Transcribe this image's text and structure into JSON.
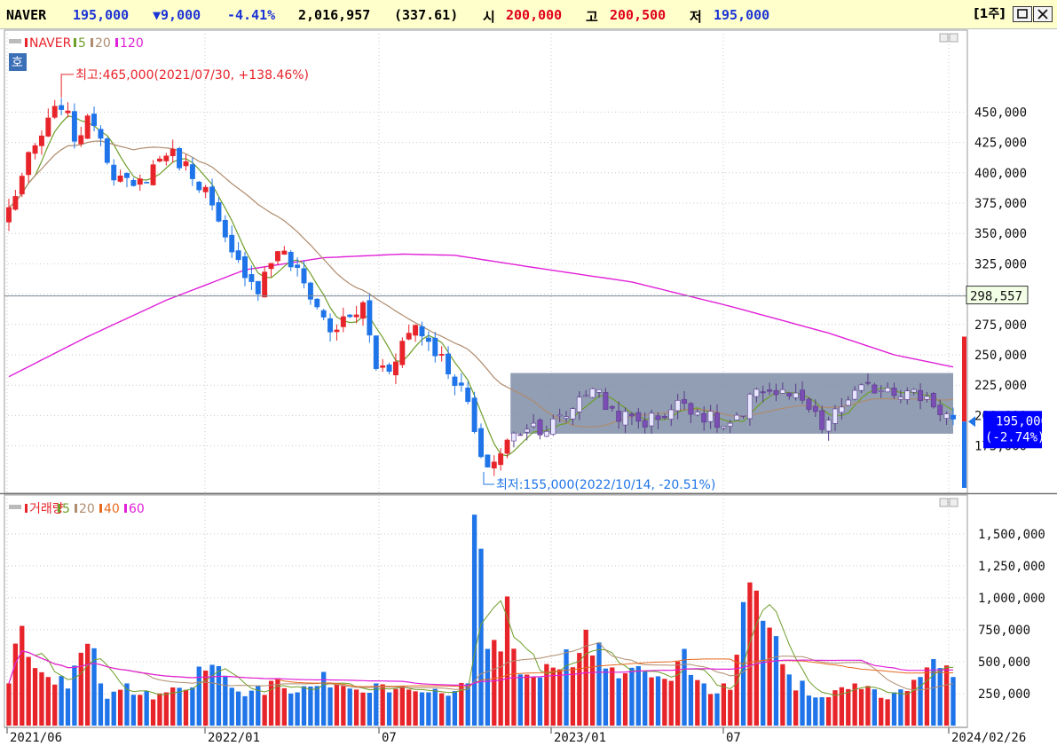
{
  "header": {
    "ticker": "NAVER",
    "price": "195,000",
    "change": "▼9,000",
    "change_pct": "-4.41%",
    "volume": "2,016,957",
    "volume_ratio": "(337.61)",
    "open_label": "시",
    "open": "200,000",
    "high_label": "고",
    "high": "200,500",
    "low_label": "저",
    "low": "195,000",
    "period_button": "[1주]",
    "restore_icon": "restore-icon",
    "close_icon": "close-icon"
  },
  "colors": {
    "up": "#e8242b",
    "down": "#1e74e8",
    "ma5": "#6e9e2a",
    "ma20": "#b08c6e",
    "ma40": "#e66a1e",
    "ma60_120": "#e020d8",
    "box": "#8291a8",
    "current": "#0000ff"
  },
  "chart_data": [
    {
      "type": "candlestick",
      "title": "NAVER",
      "legend": [
        {
          "label": "NAVER",
          "color": "#e8242b"
        },
        {
          "label": "5",
          "color": "#6e9e2a"
        },
        {
          "label": "20",
          "color": "#b08c6e"
        },
        {
          "label": "120",
          "color": "#e020d8"
        }
      ],
      "hoga_button": "호",
      "y_ticks": [
        "450,000",
        "425,000",
        "400,000",
        "375,000",
        "350,000",
        "325,000",
        "300,000",
        "275,000",
        "250,000",
        "225,000",
        "200,000",
        "175,000"
      ],
      "ylim": [
        155000,
        470000
      ],
      "x_labels": [
        "2021/06",
        "2022/01",
        "07",
        "2023/01",
        "07",
        "2024/02/26"
      ],
      "annotations": {
        "high": "최고:465,000(2021/07/30, +138.46%)",
        "low": "최저:155,000(2022/10/14, -20.51%)",
        "crosshair_value": "298,557",
        "current_price": "195,000",
        "current_pct": "(-2.74%)"
      },
      "box_range": {
        "x_start": "2022/11",
        "x_end": "2024/02/26",
        "y_low": 185000,
        "y_high": 235000
      },
      "weeks": 145,
      "x_start": "2021/05/31",
      "x_end": "2024/02/26",
      "close_anchors": [
        [
          0,
          370000
        ],
        [
          3,
          410000
        ],
        [
          6,
          440000
        ],
        [
          8,
          458000
        ],
        [
          10,
          430000
        ],
        [
          13,
          445000
        ],
        [
          16,
          400000
        ],
        [
          19,
          385000
        ],
        [
          22,
          405000
        ],
        [
          24,
          418000
        ],
        [
          26,
          410000
        ],
        [
          28,
          400000
        ],
        [
          30,
          385000
        ],
        [
          32,
          355000
        ],
        [
          34,
          330000
        ],
        [
          36,
          320000
        ],
        [
          38,
          305000
        ],
        [
          41,
          338000
        ],
        [
          43,
          325000
        ],
        [
          46,
          300000
        ],
        [
          49,
          270000
        ],
        [
          52,
          280000
        ],
        [
          54,
          290000
        ],
        [
          56,
          240000
        ],
        [
          58,
          240000
        ],
        [
          60,
          260000
        ],
        [
          62,
          275000
        ],
        [
          65,
          255000
        ],
        [
          68,
          230000
        ],
        [
          70,
          210000
        ],
        [
          72,
          160000
        ],
        [
          74,
          162000
        ],
        [
          76,
          178000
        ],
        [
          79,
          193000
        ],
        [
          82,
          190000
        ],
        [
          85,
          200000
        ],
        [
          87,
          215000
        ],
        [
          89,
          225000
        ],
        [
          91,
          208000
        ],
        [
          94,
          198000
        ],
        [
          97,
          195000
        ],
        [
          100,
          202000
        ],
        [
          103,
          212000
        ],
        [
          106,
          200000
        ],
        [
          109,
          190000
        ],
        [
          112,
          197000
        ],
        [
          114,
          225000
        ],
        [
          116,
          220000
        ],
        [
          119,
          216000
        ],
        [
          122,
          205000
        ],
        [
          124,
          190000
        ],
        [
          126,
          200000
        ],
        [
          128,
          215000
        ],
        [
          131,
          222000
        ],
        [
          134,
          225000
        ],
        [
          137,
          218000
        ],
        [
          140,
          215000
        ],
        [
          142,
          205000
        ],
        [
          144,
          195000
        ]
      ],
      "ma120_anchors": [
        [
          0,
          232000
        ],
        [
          12,
          265000
        ],
        [
          24,
          295000
        ],
        [
          36,
          320000
        ],
        [
          48,
          330000
        ],
        [
          60,
          333000
        ],
        [
          68,
          332000
        ],
        [
          80,
          322000
        ],
        [
          95,
          310000
        ],
        [
          110,
          290000
        ],
        [
          125,
          268000
        ],
        [
          135,
          250000
        ],
        [
          144,
          240000
        ]
      ]
    },
    {
      "type": "bar",
      "title": "거래량",
      "legend": [
        {
          "label": "거래량",
          "color": "#e8242b"
        },
        {
          "label": "5",
          "color": "#6e9e2a"
        },
        {
          "label": "20",
          "color": "#b08c6e"
        },
        {
          "label": "40",
          "color": "#e66a1e"
        },
        {
          "label": "60",
          "color": "#e020d8"
        }
      ],
      "y_ticks": [
        "1,500,000",
        "1,250,000",
        "1,000,000",
        "750,000",
        "500,000",
        "250,000"
      ],
      "ylim": [
        0,
        1700000
      ],
      "volume_anchors": [
        [
          0,
          330000
        ],
        [
          2,
          780000
        ],
        [
          4,
          450000
        ],
        [
          6,
          380000
        ],
        [
          9,
          290000
        ],
        [
          12,
          640000
        ],
        [
          15,
          210000
        ],
        [
          18,
          330000
        ],
        [
          21,
          270000
        ],
        [
          24,
          260000
        ],
        [
          27,
          280000
        ],
        [
          30,
          430000
        ],
        [
          33,
          390000
        ],
        [
          36,
          230000
        ],
        [
          40,
          350000
        ],
        [
          44,
          260000
        ],
        [
          48,
          420000
        ],
        [
          52,
          290000
        ],
        [
          56,
          330000
        ],
        [
          60,
          310000
        ],
        [
          64,
          260000
        ],
        [
          68,
          270000
        ],
        [
          70,
          330000
        ],
        [
          71,
          1650000
        ],
        [
          73,
          600000
        ],
        [
          75,
          580000
        ],
        [
          76,
          1010000
        ],
        [
          78,
          400000
        ],
        [
          80,
          380000
        ],
        [
          84,
          440000
        ],
        [
          88,
          750000
        ],
        [
          90,
          650000
        ],
        [
          93,
          370000
        ],
        [
          97,
          420000
        ],
        [
          101,
          350000
        ],
        [
          103,
          600000
        ],
        [
          106,
          330000
        ],
        [
          110,
          280000
        ],
        [
          113,
          1120000
        ],
        [
          115,
          820000
        ],
        [
          117,
          700000
        ],
        [
          119,
          400000
        ],
        [
          123,
          220000
        ],
        [
          127,
          300000
        ],
        [
          131,
          310000
        ],
        [
          135,
          260000
        ],
        [
          139,
          380000
        ],
        [
          141,
          520000
        ],
        [
          144,
          380000
        ]
      ]
    }
  ]
}
